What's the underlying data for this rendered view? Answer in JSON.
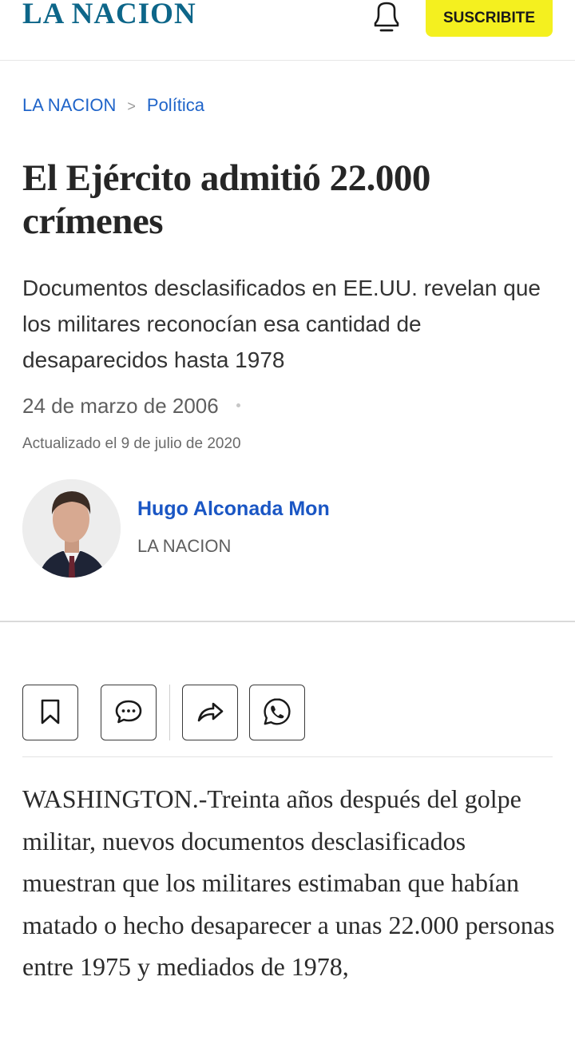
{
  "header": {
    "logo": "LA NACION",
    "subscribe_label": "SUSCRIBITE",
    "notification_icon": "bell-icon"
  },
  "breadcrumb": {
    "home": "LA NACION",
    "separator": ">",
    "section": "Política"
  },
  "article": {
    "title": "El Ejército admitió 22.000 crímenes",
    "subtitle": "Documentos desclasificados en EE.UU. revelan que los militares reconocían esa cantidad de desaparecidos hasta 1978",
    "date": "24 de marzo de 2006",
    "updated": "Actualizado el 9 de julio de 2020",
    "body": "WASHINGTON.-Treinta años después del golpe militar, nuevos documentos desclasificados muestran que los militares estimaban que habían matado o hecho desaparecer a unas 22.000 personas entre 1975 y mediados de 1978,"
  },
  "author": {
    "name": "Hugo Alconada Mon",
    "organization": "LA NACION"
  },
  "actions": [
    {
      "name": "save",
      "icon": "bookmark-icon"
    },
    {
      "name": "comment",
      "icon": "comment-icon"
    },
    {
      "name": "share",
      "icon": "share-icon"
    },
    {
      "name": "whatsapp",
      "icon": "whatsapp-icon"
    }
  ],
  "colors": {
    "brand": "#0d6689",
    "link": "#1f64c9",
    "subscribe_bg": "#f4f01f"
  }
}
